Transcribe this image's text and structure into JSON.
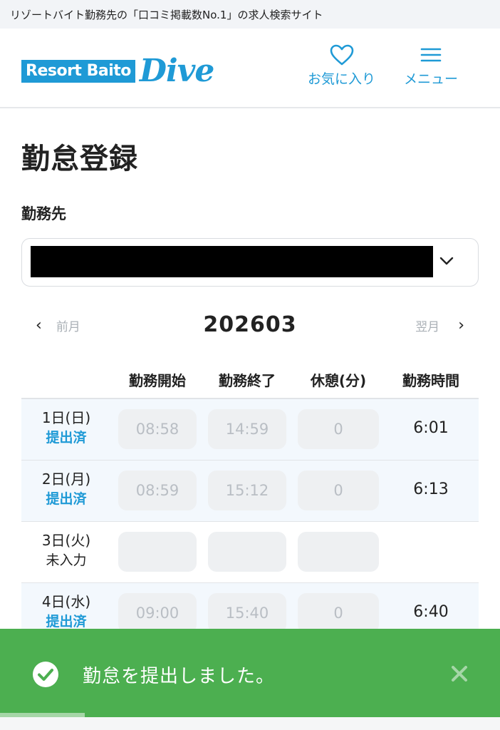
{
  "tagline": "リゾートバイト勤務先の「口コミ掲載数No.1」の求人検索サイト",
  "logo": {
    "box_text": "Resort Baito",
    "script_text": "Dive"
  },
  "header": {
    "favorites_label": "お気に入り",
    "menu_label": "メニュー"
  },
  "page": {
    "title": "勤怠登録",
    "workplace_label": "勤務先"
  },
  "month_nav": {
    "prev_label": "前月",
    "current": "202603",
    "next_label": "翌月"
  },
  "table": {
    "headers": [
      "勤務開始",
      "勤務終了",
      "休憩(分)",
      "勤務時間"
    ],
    "rows": [
      {
        "date": "1日(日)",
        "status": "提出済",
        "start": "08:58",
        "end": "14:59",
        "break": "0",
        "total": "6:01"
      },
      {
        "date": "2日(月)",
        "status": "提出済",
        "start": "08:59",
        "end": "15:12",
        "break": "0",
        "total": "6:13"
      },
      {
        "date": "3日(火)",
        "status": "未入力",
        "start": "",
        "end": "",
        "break": "",
        "total": ""
      },
      {
        "date": "4日(水)",
        "status": "提出済",
        "start": "09:00",
        "end": "15:40",
        "break": "0",
        "total": "6:40"
      }
    ]
  },
  "toast": {
    "message": "勤怠を提出しました。",
    "progress": 0.17
  },
  "colors": {
    "brand": "#1f9ad6",
    "toast": "#4caf50"
  }
}
